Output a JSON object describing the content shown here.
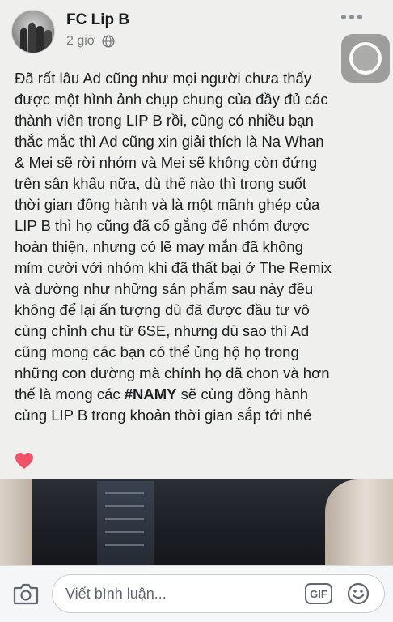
{
  "post": {
    "author": "FC Lip B",
    "time": "2 giờ",
    "privacy_icon": "globe-icon",
    "more_icon": "more-options-icon",
    "body_lines": [
      "Đã rất lâu Ad cũng như mọi người chưa thấy",
      "được một hình ảnh chụp chung của đầy đủ các",
      "thành viên trong LIP B rồi, cũng có nhiều bạn",
      "thắc mắc thì Ad cũng xin giải thích là Na Whan",
      "& Mei sẽ rời nhóm và Mei sẽ không còn đứng",
      "trên sân khấu nữa, dù thế nào thì trong suốt",
      "thời gian đồng hành và là một mãnh ghép của",
      "LIP B thì họ cũng đã cố gắng để nhóm được",
      "hoàn thiện, nhưng có lẽ may mắn đã không",
      "mỉm cười với nhóm khi đã thất bại ở The Remix",
      "và dường như những sản phẩm sau này đều",
      "không để lại ấn tượng dù đã được đầu tư vô",
      "cùng chỉnh chu từ 6SE, nhưng dù sao thì Ad",
      "cũng mong các bạn có thể ủng hộ họ trong",
      "những con đường mà chính họ đã chon và hơn"
    ],
    "line_16_before": "thế là mong các ",
    "hashtag": "#NAMY",
    "line_16_after": "  sẽ cùng đồng hành",
    "line_17": "cùng LIP B trong khoản thời gian sắp tới nhé",
    "emoji_icon": "heart-icon"
  },
  "comment_bar": {
    "placeholder": "Viết bình luận...",
    "gif_label": "GIF",
    "camera_icon": "camera-icon",
    "sticker_icon": "smiley-sticker-icon"
  },
  "colors": {
    "background": "#efefed",
    "text": "#1c1e21",
    "meta": "#7a7c80",
    "heart": "#f25268"
  }
}
